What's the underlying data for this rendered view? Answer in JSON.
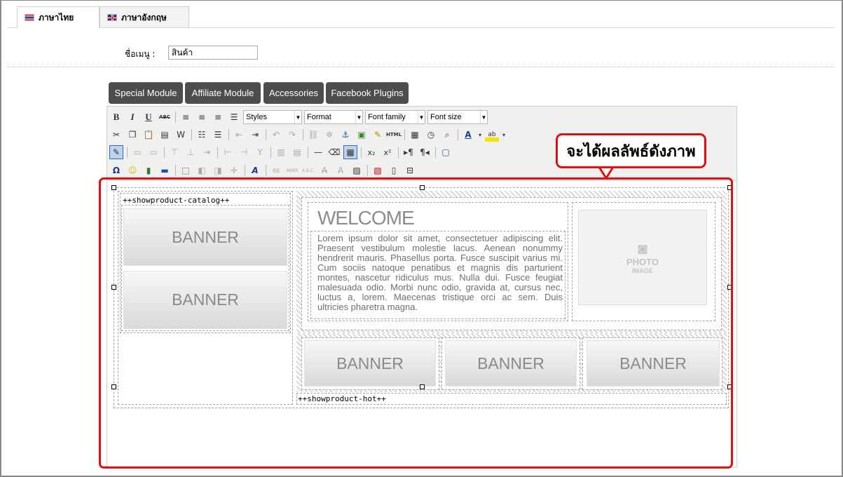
{
  "tabs": [
    {
      "label": "ภาษาไทย",
      "flag": "thai-flag-icon",
      "active": true
    },
    {
      "label": "ภาษาอังกฤษ",
      "flag": "uk-flag-icon",
      "active": false
    }
  ],
  "form": {
    "menu_name_label": "ชื่อเมนู :",
    "menu_name_value": "สินค้า"
  },
  "module_buttons": [
    "Special Module",
    "Affiliate Module",
    "Accessories",
    "Facebook Plugins"
  ],
  "toolbar": {
    "bold": "B",
    "italic": "I",
    "underline": "U",
    "strikethrough": "ABC",
    "styles": "Styles",
    "format": "Format",
    "font_family": "Font family",
    "font_size": "Font size",
    "html_label": "HTML",
    "omega": "Ω"
  },
  "content": {
    "catalog_tag": "++showproduct-catalog++",
    "hot_tag": "++showproduct-hot++",
    "banner_text": "BANNER",
    "welcome_title": "WELCOME",
    "lorem": "Lorem ipsum dolor sit amet, consectetuer adipiscing elit. Praesent vestibulum molestie lacus. Aenean nonummy hendrerit mauris. Phasellus porta. Fusce suscipit varius mi. Cum sociis natoque penatibus et magnis dis parturient montes, nascetur ridiculus mus. Nulla dui. Fusce feugiat malesuada odio. Morbi nunc odio, gravida at, cursus nec, luctus a, lorem. Maecenas tristique orci ac sem. Duis ultricies pharetra magna.",
    "photo_title": "PHOTO",
    "photo_sub": "IMAGE"
  },
  "annotation": {
    "callout_text": "จะได้ผลลัพธ์ดังภาพ",
    "color": "#e01010"
  }
}
